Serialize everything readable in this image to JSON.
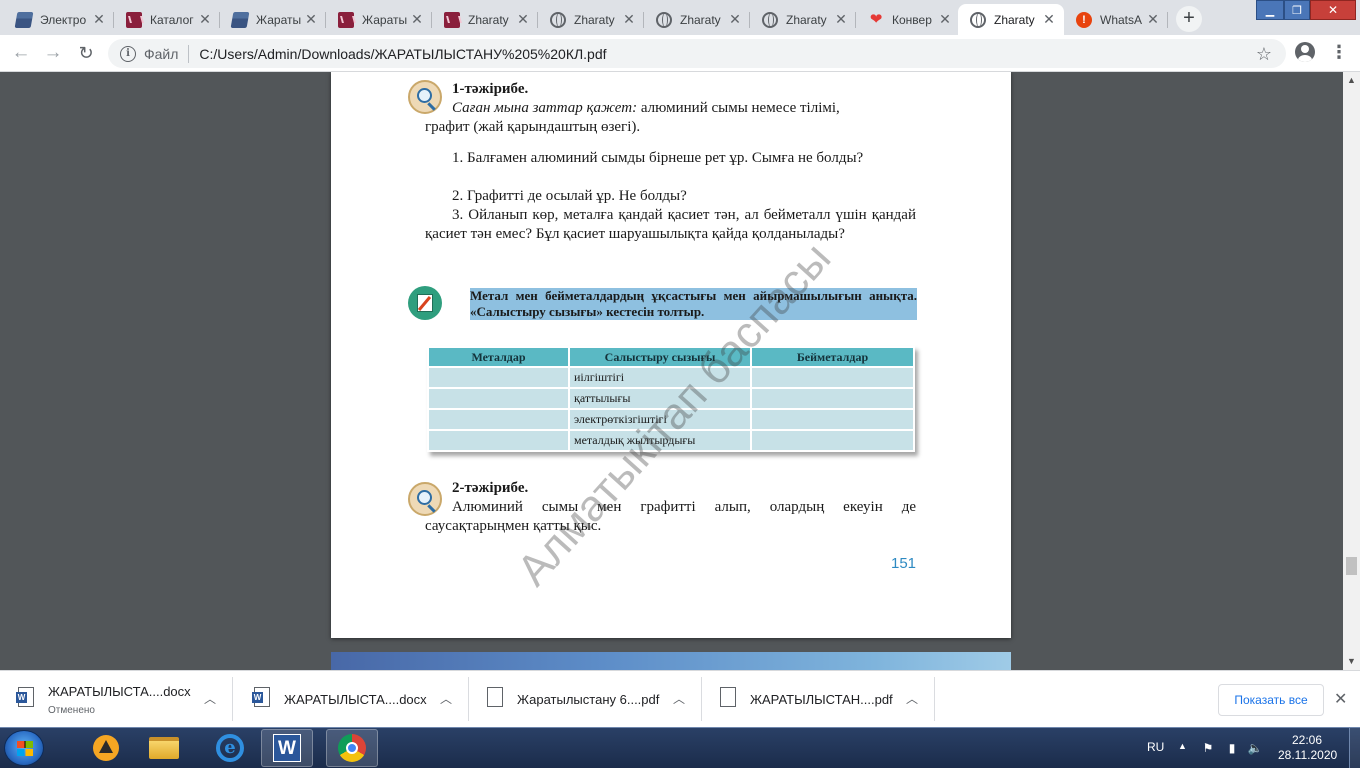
{
  "tabs": [
    {
      "title": "Электро",
      "icon": "book-icon"
    },
    {
      "title": "Каталог",
      "icon": "pdf-reader-icon"
    },
    {
      "title": "Жараты",
      "icon": "book-icon"
    },
    {
      "title": "Жараты",
      "icon": "pdf-reader-icon"
    },
    {
      "title": "Zharaty",
      "icon": "pdf-reader-icon"
    },
    {
      "title": "Zharaty",
      "icon": "globe-icon"
    },
    {
      "title": "Zharaty",
      "icon": "globe-icon"
    },
    {
      "title": "Zharaty",
      "icon": "globe-icon"
    },
    {
      "title": "Конвер",
      "icon": "heart-icon"
    },
    {
      "title": "Zharaty",
      "icon": "globe-icon"
    },
    {
      "title": "WhatsA",
      "icon": "whatsapp-icon"
    }
  ],
  "address": {
    "scheme_label": "Файл",
    "url": "C:/Users/Admin/Downloads/ЖАРАТЫЛЫСТАНУ%205%20КЛ.pdf"
  },
  "pdf": {
    "exp1_title": "1-тәжірибе.",
    "exp1_need_italic": "Саған мына заттар қажет:",
    "exp1_need_line1": " алюминий сымы немесе тілімі,",
    "exp1_need_line2": "графит (жай қарындаштың өзегі).",
    "steps": [
      "1. Балғамен алюминий сымды бірнеше рет ұр. Сымға не болды?",
      "2.  Графитті де осылай ұр. Не болды?",
      "3. Ойланып көр, металға қандай қасиет тән, ал бейметалл үшін қандай қасиет тән емес? Бұл қасиет  шаруашылықта қайда қолданылады?"
    ],
    "task_text": "Метал мен бейметалдардың ұқсастығы мен айырмашылығын анықта. «Салыстыру сызығы» кестесін толтыр.",
    "table": {
      "headers": [
        "Металдар",
        "Салыстыру сызығы",
        "Бейметалдар"
      ],
      "rows": [
        [
          "",
          "иілгіштігі",
          ""
        ],
        [
          "",
          "қаттылығы",
          ""
        ],
        [
          "",
          "электрөткізгіштігі",
          ""
        ],
        [
          "",
          "металдық жылтырдығы",
          ""
        ]
      ]
    },
    "exp2_title": "2-тәжірибе.",
    "exp2_text": "Алюминий сымы мен графитті алып, олардың екеуін де саусақтарыңмен қатты қыс.",
    "page_number": "151",
    "watermark": "Алматыкітап баспасы"
  },
  "downloads": {
    "items": [
      {
        "name": "ЖАРАТЫЛЫСТА....docx",
        "status": "Отменено",
        "type": "word"
      },
      {
        "name": "ЖАРАТЫЛЫСТА....docx",
        "status": "",
        "type": "word"
      },
      {
        "name": "Жаратылыстану 6....pdf",
        "status": "",
        "type": "file"
      },
      {
        "name": "ЖАРАТЫЛЫСТАН....pdf",
        "status": "",
        "type": "file"
      }
    ],
    "show_all_label": "Показать все"
  },
  "taskbar": {
    "word_letter": "W",
    "ie_letter": "e",
    "language": "RU",
    "time": "22:06",
    "date": "28.11.2020"
  }
}
